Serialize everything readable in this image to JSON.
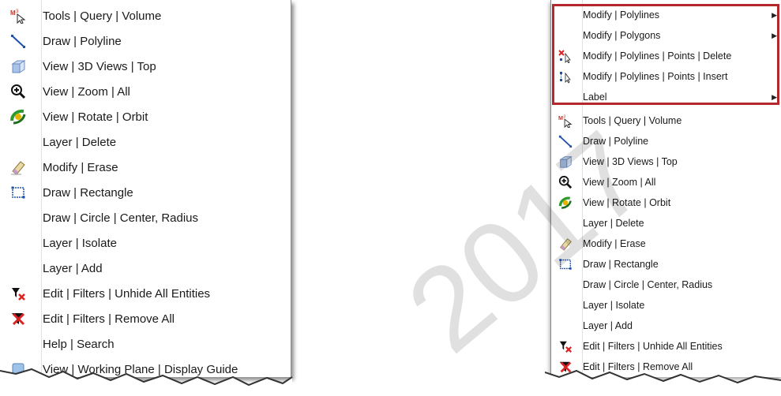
{
  "left_menu": {
    "items": [
      {
        "label": "Tools | Query | Volume",
        "icon": "query-volume-icon"
      },
      {
        "label": "Draw | Polyline",
        "icon": "polyline-icon"
      },
      {
        "label": "View | 3D Views | Top",
        "icon": "3d-view-top-icon"
      },
      {
        "label": "View | Zoom | All",
        "icon": "zoom-all-icon"
      },
      {
        "label": "View | Rotate | Orbit",
        "icon": "orbit-icon"
      },
      {
        "label": "Layer | Delete",
        "icon": ""
      },
      {
        "label": "Modify | Erase",
        "icon": "eraser-icon"
      },
      {
        "label": "Draw | Rectangle",
        "icon": "rectangle-icon"
      },
      {
        "label": "Draw | Circle | Center, Radius",
        "icon": ""
      },
      {
        "label": "Layer | Isolate",
        "icon": ""
      },
      {
        "label": "Layer | Add",
        "icon": ""
      },
      {
        "label": "Edit | Filters | Unhide All Entities",
        "icon": "filter-unhide-icon"
      },
      {
        "label": "Edit | Filters | Remove All",
        "icon": "filter-remove-icon"
      },
      {
        "label": "Help | Search",
        "icon": ""
      },
      {
        "label": "View | Working Plane | Display Guide",
        "icon": "working-plane-icon"
      }
    ]
  },
  "right_menu": {
    "items": [
      {
        "label": "Modify | Polylines",
        "icon": "",
        "submenu": true
      },
      {
        "label": "Modify | Polygons",
        "icon": "",
        "submenu": true
      },
      {
        "label": "Modify | Polylines | Points | Delete",
        "icon": "delete-points-icon"
      },
      {
        "label": "Modify | Polylines | Points | Insert",
        "icon": "insert-points-icon"
      },
      {
        "label": "Label",
        "icon": "",
        "submenu": true
      },
      {
        "label": "Tools | Query | Volume",
        "icon": "query-volume-icon"
      },
      {
        "label": "Draw | Polyline",
        "icon": "polyline-icon"
      },
      {
        "label": "View | 3D Views | Top",
        "icon": "3d-view-top-icon"
      },
      {
        "label": "View | Zoom | All",
        "icon": "zoom-all-icon"
      },
      {
        "label": "View | Rotate | Orbit",
        "icon": "orbit-icon"
      },
      {
        "label": "Layer | Delete",
        "icon": ""
      },
      {
        "label": "Modify | Erase",
        "icon": "eraser-icon"
      },
      {
        "label": "Draw | Rectangle",
        "icon": "rectangle-icon"
      },
      {
        "label": "Draw | Circle | Center, Radius",
        "icon": ""
      },
      {
        "label": "Layer | Isolate",
        "icon": ""
      },
      {
        "label": "Layer | Add",
        "icon": ""
      },
      {
        "label": "Edit | Filters | Unhide All Entities",
        "icon": "filter-unhide-icon"
      },
      {
        "label": "Edit | Filters | Remove All",
        "icon": "filter-remove-icon"
      }
    ]
  },
  "watermark": "2017",
  "colors": {
    "highlight": "#b3282d",
    "separator": "#e2e2e2"
  }
}
